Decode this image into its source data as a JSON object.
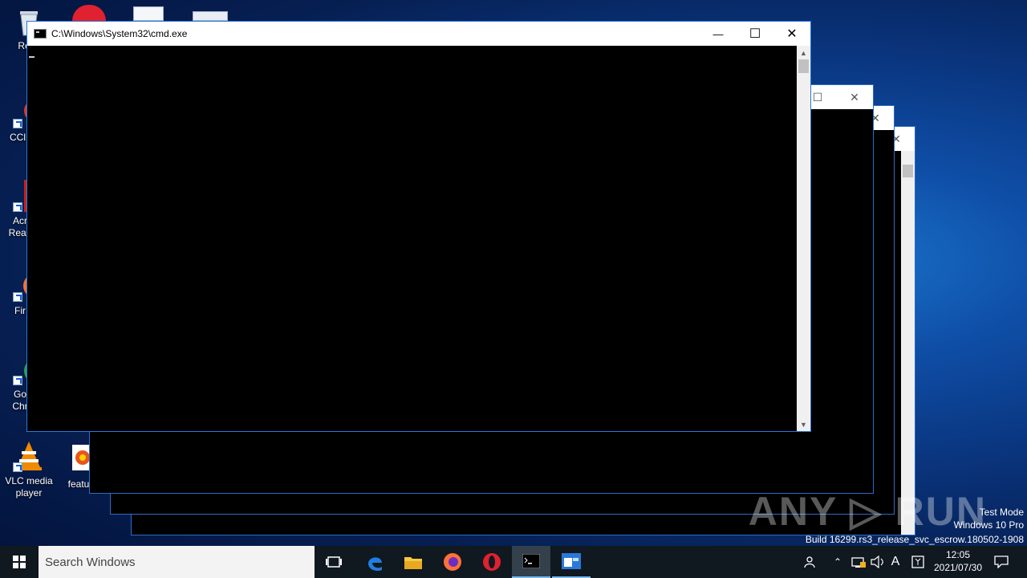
{
  "desktop": {
    "icons": [
      {
        "label": "Recy"
      },
      {
        "label": "CCl"
      },
      {
        "label": "Acr\nRead"
      },
      {
        "label": "Fir"
      },
      {
        "label": "Go\nChr"
      },
      {
        "label": "VLC media\nplayer"
      },
      {
        "label": "featur"
      }
    ]
  },
  "cmd_window": {
    "title": "C:\\Windows\\System32\\cmd.exe",
    "minimize": "—",
    "maximize": "☐",
    "close": "✕"
  },
  "background_windows": {
    "maximize": "☐",
    "close": "✕",
    "minimize": "—"
  },
  "watermark": {
    "brand": "ANY ▷ RUN",
    "line1": "Test Mode",
    "line2": "Windows 10 Pro",
    "line3": "Build 16299.rs3_release_svc_escrow.180502-1908"
  },
  "taskbar": {
    "search_placeholder": "Search Windows",
    "time": "12:05",
    "date": "2021/07/30",
    "ime": "A"
  },
  "colors": {
    "accent": "#2b78d8",
    "taskbar_bg": "#101820",
    "console_bg": "#000000"
  }
}
